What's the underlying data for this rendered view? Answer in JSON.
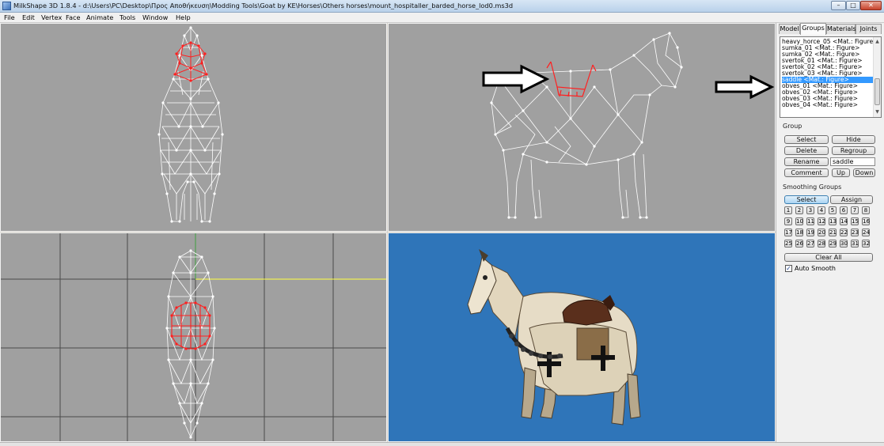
{
  "window": {
    "title": "MilkShape 3D 1.8.4 - d:\\Users\\PC\\Desktop\\Προς Αποθήκευση\\Modding Tools\\Goat by KE\\Horses\\Others horses\\mount_hospitaller_barded_horse_lod0.ms3d",
    "minimize": "–",
    "maximize": "□",
    "close": "✕"
  },
  "menu": [
    "File",
    "Edit",
    "Vertex",
    "Face",
    "Animate",
    "Tools",
    "Window",
    "Help"
  ],
  "tabs": [
    {
      "label": "Model",
      "active": false
    },
    {
      "label": "Groups",
      "active": true
    },
    {
      "label": "Materials",
      "active": false
    },
    {
      "label": "Joints",
      "active": false
    }
  ],
  "groups": {
    "items": [
      "heavy_horce_05 <Mat.: Figure>",
      "sumka_01 <Mat.: Figure>",
      "sumka_02 <Mat.: Figure>",
      "svertok_01 <Mat.: Figure>",
      "svertok_02 <Mat.: Figure>",
      "svertok_03 <Mat.: Figure>",
      "saddle <Mat.: Figure>",
      "obves_01 <Mat.: Figure>",
      "obves_02 <Mat.: Figure>",
      "obves_03 <Mat.: Figure>",
      "obves_04 <Mat.: Figure>"
    ],
    "selected_index": 6,
    "section_label": "Group",
    "select_label": "Select",
    "hide_label": "Hide",
    "delete_label": "Delete",
    "regroup_label": "Regroup",
    "rename_label": "Rename",
    "name_value": "saddle",
    "comment_label": "Comment",
    "up_label": "Up",
    "down_label": "Down"
  },
  "smoothing": {
    "section_label": "Smoothing Groups",
    "select_label": "Select",
    "assign_label": "Assign",
    "numbers": [
      "1",
      "2",
      "3",
      "4",
      "5",
      "6",
      "7",
      "8",
      "9",
      "10",
      "11",
      "12",
      "13",
      "14",
      "15",
      "16",
      "17",
      "18",
      "19",
      "20",
      "21",
      "22",
      "23",
      "24",
      "25",
      "26",
      "27",
      "28",
      "29",
      "30",
      "31",
      "32"
    ],
    "clear_all_label": "Clear All",
    "auto_smooth_label": "Auto Smooth",
    "auto_smooth_checked": true
  },
  "colors": {
    "viewport_bg": "#a0a0a0",
    "render_bg": "#2f75b9",
    "selection_highlight": "#3399ff",
    "selected_mesh": "#ff2020",
    "wireframe": "#ffffff"
  }
}
